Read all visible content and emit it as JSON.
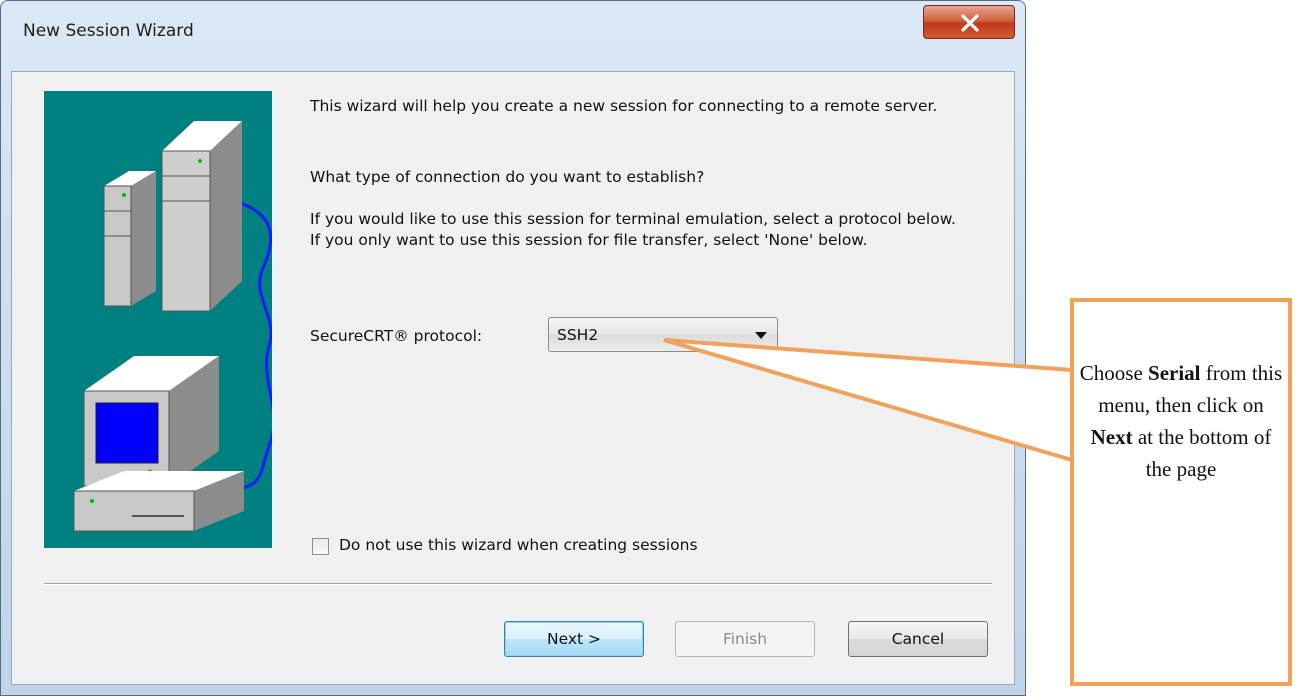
{
  "window": {
    "title": "New Session Wizard",
    "close_icon": "close-icon"
  },
  "body": {
    "intro": "This wizard will help you create a new session for connecting to a remote server.",
    "question": "What type of connection do you want to establish?",
    "instructions": "If you would like to use this session for terminal emulation, select a protocol below.  If you only want to use this session for file transfer, select 'None' below."
  },
  "protocol": {
    "label": "SecureCRT® protocol:",
    "value": "SSH2"
  },
  "checkbox": {
    "label": "Do not use this wizard when creating sessions",
    "checked": false
  },
  "buttons": {
    "next": "Next >",
    "finish": "Finish",
    "cancel": "Cancel"
  },
  "callout": {
    "part1": "Choose ",
    "bold1": "Serial",
    "part2": " from this menu, then click on ",
    "bold2": "Next",
    "part3": " at the bottom of the page"
  },
  "colors": {
    "illustration_bg": "#008080",
    "callout_border": "#f2a05a",
    "screen_blue": "#0000ff"
  }
}
